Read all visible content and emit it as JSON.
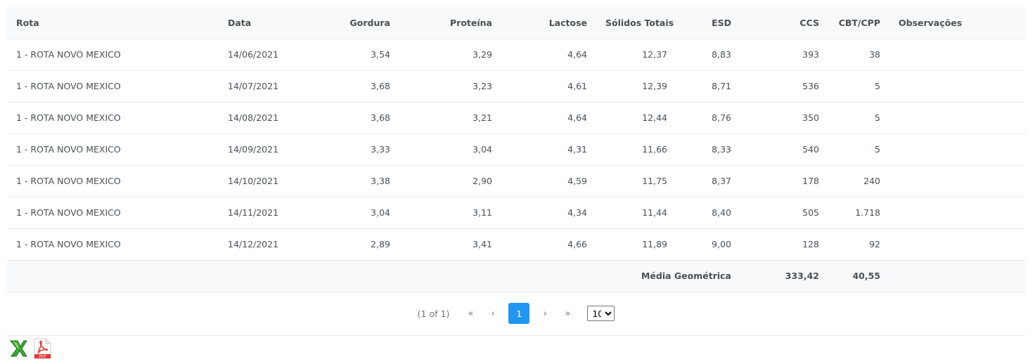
{
  "table": {
    "columns": [
      "Rota",
      "Data",
      "Gordura",
      "Proteína",
      "Lactose",
      "Sólidos Totais",
      "ESD",
      "CCS",
      "CBT/CPP",
      "Observações"
    ],
    "rows": [
      [
        "1 - ROTA NOVO MEXICO",
        "14/06/2021",
        "3,54",
        "3,29",
        "4,64",
        "12,37",
        "8,83",
        "393",
        "38",
        ""
      ],
      [
        "1 - ROTA NOVO MEXICO",
        "14/07/2021",
        "3,68",
        "3,23",
        "4,61",
        "12,39",
        "8,71",
        "536",
        "5",
        ""
      ],
      [
        "1 - ROTA NOVO MEXICO",
        "14/08/2021",
        "3,68",
        "3,21",
        "4,64",
        "12,44",
        "8,76",
        "350",
        "5",
        ""
      ],
      [
        "1 - ROTA NOVO MEXICO",
        "14/09/2021",
        "3,33",
        "3,04",
        "4,31",
        "11,66",
        "8,33",
        "540",
        "5",
        ""
      ],
      [
        "1 - ROTA NOVO MEXICO",
        "14/10/2021",
        "3,38",
        "2,90",
        "4,59",
        "11,75",
        "8,37",
        "178",
        "240",
        ""
      ],
      [
        "1 - ROTA NOVO MEXICO",
        "14/11/2021",
        "3,04",
        "3,11",
        "4,34",
        "11,44",
        "8,40",
        "505",
        "1.718",
        ""
      ],
      [
        "1 - ROTA NOVO MEXICO",
        "14/12/2021",
        "2,89",
        "3,41",
        "4,66",
        "11,89",
        "9,00",
        "128",
        "92",
        ""
      ]
    ],
    "footer": {
      "label": "Média Geométrica",
      "ccs": "333,42",
      "cbt": "40,55"
    }
  },
  "paginator": {
    "report": "(1 of 1)",
    "first": "«",
    "prev": "‹",
    "page": "1",
    "next": "›",
    "last": "»",
    "rows_per_page": "10",
    "rows_options": [
      "10"
    ]
  },
  "export": {
    "excel_icon": "excel-export-icon",
    "pdf_icon": "pdf-export-icon",
    "pdf_text": "PDF"
  },
  "colors": {
    "header_bg": "#f8f9fa",
    "border": "#e9ecef",
    "text": "#495057",
    "accent": "#2196f3"
  }
}
